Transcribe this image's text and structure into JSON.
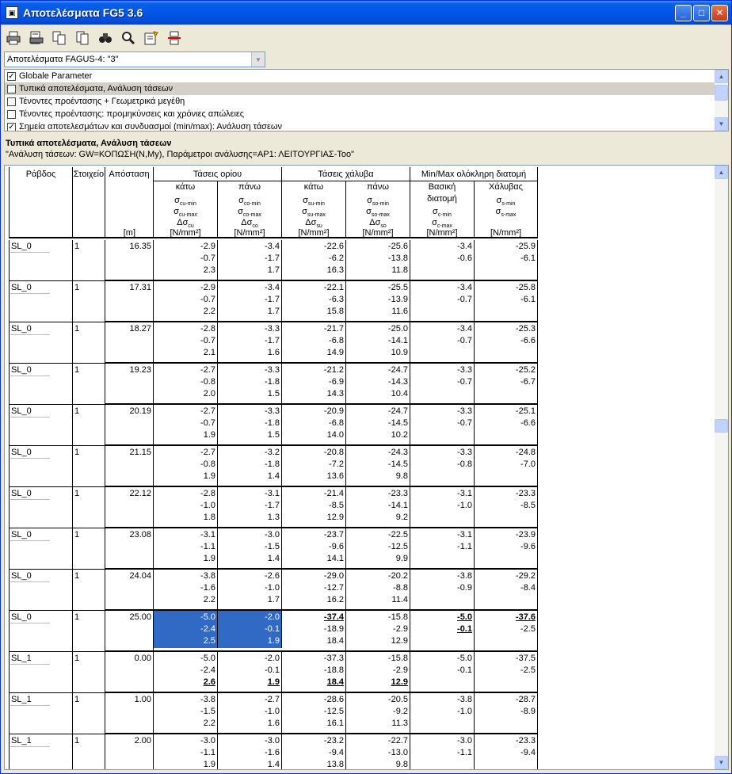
{
  "window": {
    "title": "Αποτελέσματα FG5 3.6",
    "minimize": "_",
    "maximize": "□",
    "close": "✕"
  },
  "toolbar": {
    "icons": [
      "print-icon",
      "print-preview-icon",
      "copy-icon",
      "paste-icon",
      "find-icon",
      "zoom-icon",
      "properties-icon",
      "page-break-icon"
    ]
  },
  "combo": {
    "value": "Αποτελέσματα FAGUS-4: \"3\""
  },
  "checklist": {
    "items": [
      {
        "label": "Globale Parameter",
        "checked": true
      },
      {
        "label": "Τυπικά αποτελέσματα, Ανάλυση τάσεων",
        "checked": false
      },
      {
        "label": "Τένοντες προέντασης + Γεωμετρικά μεγέθη",
        "checked": false
      },
      {
        "label": "Τένοντες προέντασης: προμηκύνσεις και χρόνιες απώλειες",
        "checked": false
      },
      {
        "label": "Σημεία αποτελεσμάτων και συνδυασμοί (min/max): Ανάλυση τάσεων",
        "checked": true
      }
    ]
  },
  "report": {
    "title": "Τυπικά αποτελέσματα, Ανάλυση τάσεων",
    "subtitle": "\"Ανάλυση τάσεων: GW=ΚΟΠΩΣΗ(N,My), Παράμετροι ανάλυσης=ΑΡ1: ΛΕΙΤΟΥΡΓΙΑΣ-Τοο\"",
    "headers": {
      "rabdos": "Ράβδος",
      "stoixeio": "Στοιχείο",
      "apostasi": "Απόσταση",
      "apostasi_unit": "[m]",
      "taseis_oriou": "Τάσεις ορίου",
      "taseis_xaluva": "Τάσεις χάλυβα",
      "minmax": "Min/Max ολόκληρη διατομή",
      "kato": "κάτω",
      "pano": "πάνω",
      "vasiki": "Βασική",
      "diatomi": "διατομή",
      "xaluvas": "Χάλυβας",
      "unit": "[N/mm²]"
    },
    "symbols": {
      "c1": [
        "σcu-min",
        "σcu-max",
        "Δσcu"
      ],
      "c2": [
        "σco-min",
        "σco-max",
        "Δσco"
      ],
      "s1": [
        "σsu-min",
        "σsu-max",
        "Δσsu"
      ],
      "s2": [
        "σso-min",
        "σso-max",
        "Δσso"
      ],
      "m1": [
        "σc-min",
        "σc-max"
      ],
      "m2": [
        "σs-min",
        "σs-max"
      ]
    },
    "rows": [
      {
        "bar": "SL_0",
        "el": "1",
        "x": "16.35",
        "c1": [
          "-2.9",
          "-0.7",
          "2.3"
        ],
        "c2": [
          "-3.4",
          "-1.7",
          "1.7"
        ],
        "s1": [
          "-22.6",
          "-6.2",
          "16.3"
        ],
        "s2": [
          "-25.6",
          "-13.8",
          "11.8"
        ],
        "m1": [
          "-3.4",
          "-0.6",
          ""
        ],
        "m2": [
          "-25.9",
          "-6.1",
          ""
        ]
      },
      {
        "bar": "SL_0",
        "el": "1",
        "x": "17.31",
        "c1": [
          "-2.9",
          "-0.7",
          "2.2"
        ],
        "c2": [
          "-3.4",
          "-1.7",
          "1.7"
        ],
        "s1": [
          "-22.1",
          "-6.3",
          "15.8"
        ],
        "s2": [
          "-25.5",
          "-13.9",
          "11.6"
        ],
        "m1": [
          "-3.4",
          "-0.7",
          ""
        ],
        "m2": [
          "-25.8",
          "-6.1",
          ""
        ]
      },
      {
        "bar": "SL_0",
        "el": "1",
        "x": "18.27",
        "c1": [
          "-2.8",
          "-0.7",
          "2.1"
        ],
        "c2": [
          "-3.3",
          "-1.7",
          "1.6"
        ],
        "s1": [
          "-21.7",
          "-6.8",
          "14.9"
        ],
        "s2": [
          "-25.0",
          "-14.1",
          "10.9"
        ],
        "m1": [
          "-3.4",
          "-0.7",
          ""
        ],
        "m2": [
          "-25.3",
          "-6.6",
          ""
        ]
      },
      {
        "bar": "SL_0",
        "el": "1",
        "x": "19.23",
        "c1": [
          "-2.7",
          "-0.8",
          "2.0"
        ],
        "c2": [
          "-3.3",
          "-1.8",
          "1.5"
        ],
        "s1": [
          "-21.2",
          "-6.9",
          "14.3"
        ],
        "s2": [
          "-24.7",
          "-14.3",
          "10.4"
        ],
        "m1": [
          "-3.3",
          "-0.7",
          ""
        ],
        "m2": [
          "-25.2",
          "-6.7",
          ""
        ]
      },
      {
        "bar": "SL_0",
        "el": "1",
        "x": "20.19",
        "c1": [
          "-2.7",
          "-0.7",
          "1.9"
        ],
        "c2": [
          "-3.3",
          "-1.8",
          "1.5"
        ],
        "s1": [
          "-20.9",
          "-6.8",
          "14.0"
        ],
        "s2": [
          "-24.7",
          "-14.5",
          "10.2"
        ],
        "m1": [
          "-3.3",
          "-0.7",
          ""
        ],
        "m2": [
          "-25.1",
          "-6.6",
          ""
        ]
      },
      {
        "bar": "SL_0",
        "el": "1",
        "x": "21.15",
        "c1": [
          "-2.7",
          "-0.8",
          "1.9"
        ],
        "c2": [
          "-3.2",
          "-1.8",
          "1.4"
        ],
        "s1": [
          "-20.8",
          "-7.2",
          "13.6"
        ],
        "s2": [
          "-24.3",
          "-14.5",
          "9.8"
        ],
        "m1": [
          "-3.3",
          "-0.8",
          ""
        ],
        "m2": [
          "-24.8",
          "-7.0",
          ""
        ]
      },
      {
        "bar": "SL_0",
        "el": "1",
        "x": "22.12",
        "c1": [
          "-2.8",
          "-1.0",
          "1.8"
        ],
        "c2": [
          "-3.1",
          "-1.7",
          "1.3"
        ],
        "s1": [
          "-21.4",
          "-8.5",
          "12.9"
        ],
        "s2": [
          "-23.3",
          "-14.1",
          "9.2"
        ],
        "m1": [
          "-3.1",
          "-1.0",
          ""
        ],
        "m2": [
          "-23.3",
          "-8.5",
          ""
        ]
      },
      {
        "bar": "SL_0",
        "el": "1",
        "x": "23.08",
        "c1": [
          "-3.1",
          "-1.1",
          "1.9"
        ],
        "c2": [
          "-3.0",
          "-1.5",
          "1.4"
        ],
        "s1": [
          "-23.7",
          "-9.6",
          "14.1"
        ],
        "s2": [
          "-22.5",
          "-12.5",
          "9.9"
        ],
        "m1": [
          "-3.1",
          "-1.1",
          ""
        ],
        "m2": [
          "-23.9",
          "-9.6",
          ""
        ]
      },
      {
        "bar": "SL_0",
        "el": "1",
        "x": "24.04",
        "c1": [
          "-3.8",
          "-1.6",
          "2.2"
        ],
        "c2": [
          "-2.6",
          "-1.0",
          "1.7"
        ],
        "s1": [
          "-29.0",
          "-12.7",
          "16.2"
        ],
        "s2": [
          "-20.2",
          "-8.8",
          "11.4"
        ],
        "m1": [
          "-3.8",
          "-0.9",
          ""
        ],
        "m2": [
          "-29.2",
          "-8.4",
          ""
        ]
      },
      {
        "bar": "SL_0",
        "el": "1",
        "x": "25.00",
        "c1": [
          "-5.0",
          "-2.4",
          "2.5"
        ],
        "c2": [
          "-2.0",
          "-0.1",
          "1.9"
        ],
        "s1": [
          "-37.4",
          "-18.9",
          "18.4"
        ],
        "s2": [
          "-15.8",
          "-2.9",
          "12.9"
        ],
        "m1": [
          "-5.0",
          "-0.1",
          ""
        ],
        "m2": [
          "-37.6",
          "-2.5",
          ""
        ]
      },
      {
        "bar": "SL_1",
        "el": "1",
        "x": "0.00",
        "c1": [
          "-5.0",
          "-2.4",
          "2.6"
        ],
        "c2": [
          "-2.0",
          "-0.1",
          "1.9"
        ],
        "s1": [
          "-37.3",
          "-18.8",
          "18.4"
        ],
        "s2": [
          "-15.8",
          "-2.9",
          "12.9"
        ],
        "m1": [
          "-5.0",
          "-0.1",
          ""
        ],
        "m2": [
          "-37.5",
          "-2.5",
          ""
        ]
      },
      {
        "bar": "SL_1",
        "el": "1",
        "x": "1.00",
        "c1": [
          "-3.8",
          "-1.5",
          "2.2"
        ],
        "c2": [
          "-2.7",
          "-1.0",
          "1.6"
        ],
        "s1": [
          "-28.6",
          "-12.5",
          "16.1"
        ],
        "s2": [
          "-20.5",
          "-9.2",
          "11.3"
        ],
        "m1": [
          "-3.8",
          "-1.0",
          ""
        ],
        "m2": [
          "-28.7",
          "-8.9",
          ""
        ]
      },
      {
        "bar": "SL_1",
        "el": "1",
        "x": "2.00",
        "c1": [
          "-3.0",
          "-1.1",
          "1.9"
        ],
        "c2": [
          "-3.0",
          "-1.6",
          "1.4"
        ],
        "s1": [
          "-23.2",
          "-9.4",
          "13.8"
        ],
        "s2": [
          "-22.7",
          "-13.0",
          "9.8"
        ],
        "m1": [
          "-3.0",
          "-1.1",
          ""
        ],
        "m2": [
          "-23.3",
          "-9.4",
          ""
        ]
      }
    ]
  }
}
